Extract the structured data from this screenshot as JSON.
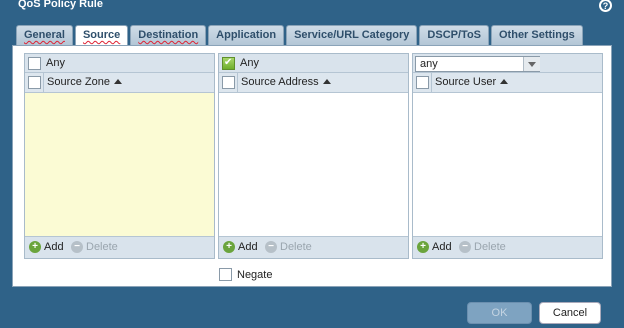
{
  "dialog": {
    "title": "QoS Policy Rule"
  },
  "tabs": [
    {
      "label": "General"
    },
    {
      "label": "Source"
    },
    {
      "label": "Destination"
    },
    {
      "label": "Application"
    },
    {
      "label": "Service/URL Category"
    },
    {
      "label": "DSCP/ToS"
    },
    {
      "label": "Other Settings"
    }
  ],
  "source_zone": {
    "any_label": "Any",
    "any_checked": false,
    "column_header": "Source Zone",
    "add_label": "Add",
    "delete_label": "Delete"
  },
  "source_address": {
    "any_label": "Any",
    "any_checked": true,
    "column_header": "Source Address",
    "add_label": "Add",
    "delete_label": "Delete",
    "negate_label": "Negate"
  },
  "source_user": {
    "selected_value": "any",
    "column_header": "Source User",
    "add_label": "Add",
    "delete_label": "Delete"
  },
  "footer": {
    "ok_label": "OK",
    "cancel_label": "Cancel"
  },
  "colors": {
    "accent": "#2f6288",
    "zone_body": "#fbfbd4",
    "tab_underline": "#d23"
  }
}
